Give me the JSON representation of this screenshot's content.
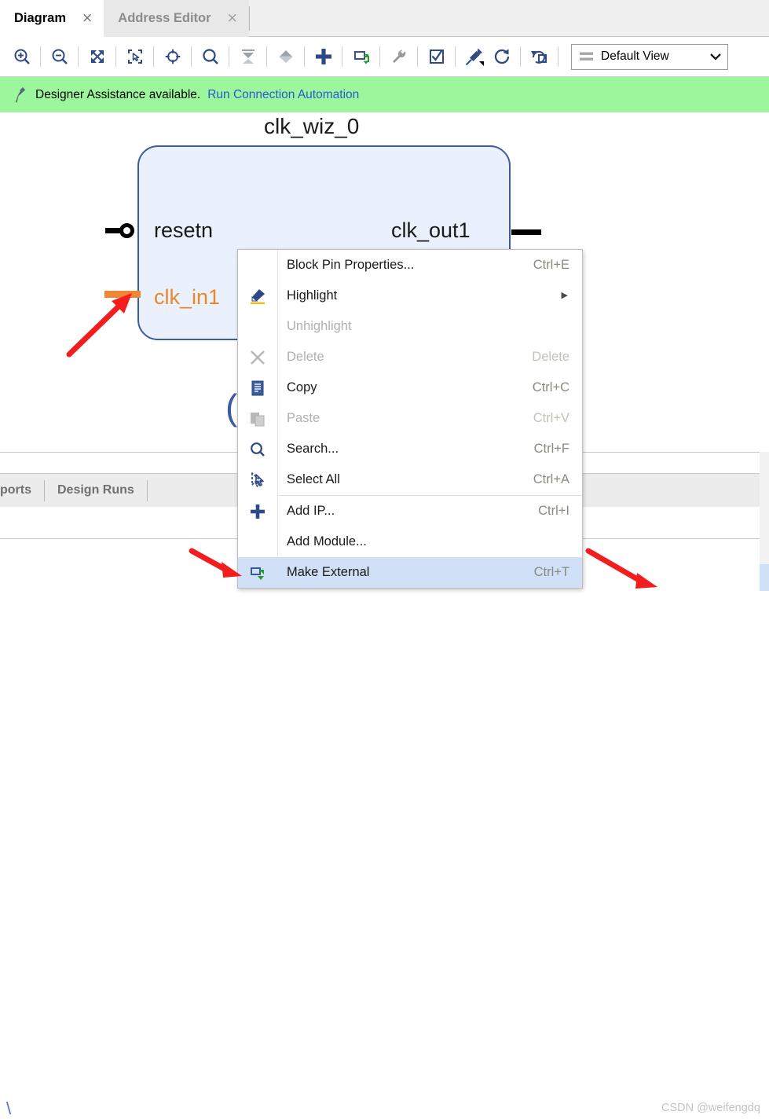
{
  "tabs": [
    {
      "label": "Diagram",
      "close": "×",
      "active": true
    },
    {
      "label": "Address Editor",
      "close": "×",
      "active": false
    }
  ],
  "toolbar": {
    "buttons": [
      {
        "name": "zoom-in-icon",
        "title": "Zoom In"
      },
      {
        "name": "zoom-out-icon",
        "title": "Zoom Out"
      },
      {
        "name": "zoom-fit-icon",
        "title": "Zoom Fit"
      },
      {
        "name": "zoom-area-icon",
        "title": "Zoom Area"
      },
      {
        "name": "fit-selection-icon",
        "title": "Fit Selection"
      },
      {
        "name": "search-icon",
        "title": "Search"
      },
      {
        "name": "collapse-all-icon",
        "title": "Collapse All"
      },
      {
        "name": "expand-all-icon",
        "title": "Expand All"
      },
      {
        "name": "add-ip-icon",
        "title": "Add IP"
      },
      {
        "name": "make-external-icon",
        "title": "Make External"
      },
      {
        "name": "settings-wrench-icon",
        "title": "Customize Block Design"
      },
      {
        "name": "validate-design-icon",
        "title": "Validate Design"
      },
      {
        "name": "pin-icon",
        "title": "Pin Lower Left"
      },
      {
        "name": "refresh-icon",
        "title": "Refresh"
      },
      {
        "name": "regenerate-layout-icon",
        "title": "Regenerate Layout"
      }
    ],
    "view_selector": {
      "label": "Default View",
      "chevron": "⌄"
    }
  },
  "assistance": {
    "icon": "designer-assistance-icon",
    "message": "Designer Assistance available.",
    "link": "Run Connection Automation",
    "background": "#9cf79c",
    "link_color": "#2a58d0"
  },
  "canvas": {
    "block": {
      "title": "clk_wiz_0",
      "fill": "#eaf1fd",
      "border": "#3b5c9e",
      "pins": [
        {
          "name": "resetn",
          "side": "left",
          "color": "#1a1a1a",
          "type": "bubble"
        },
        {
          "name": "clk_in1",
          "side": "left",
          "color": "#e8872a",
          "type": "highlighted"
        },
        {
          "name": "clk_out1",
          "side": "right",
          "color": "#1a1a1a",
          "type": "plain"
        }
      ],
      "sub_glyph": "("
    },
    "annotation_arrows": [
      {
        "name": "arrow-pointing-clk-in1-pin",
        "color": "#f41d1d"
      },
      {
        "name": "arrow-pointing-make-external",
        "color": "#f41d1d"
      },
      {
        "name": "arrow-pointing-scrollbar",
        "color": "#f41d1d"
      }
    ]
  },
  "context_menu": {
    "items": [
      {
        "label": "Block Pin Properties...",
        "accel": "Ctrl+E",
        "icon": "",
        "disabled": false,
        "submenu": false,
        "selected": false
      },
      {
        "label": "Highlight",
        "accel": "",
        "icon": "highlight-icon",
        "disabled": false,
        "submenu": true,
        "selected": false
      },
      {
        "label": "Unhighlight",
        "accel": "",
        "icon": "",
        "disabled": true,
        "submenu": false,
        "selected": false
      },
      {
        "label": "Delete",
        "accel": "Delete",
        "icon": "delete-x-icon",
        "disabled": true,
        "submenu": false,
        "selected": false
      },
      {
        "label": "Copy",
        "accel": "Ctrl+C",
        "icon": "copy-icon",
        "disabled": false,
        "submenu": false,
        "selected": false
      },
      {
        "label": "Paste",
        "accel": "Ctrl+V",
        "icon": "paste-icon",
        "disabled": true,
        "submenu": false,
        "selected": false
      },
      {
        "label": "Search...",
        "accel": "Ctrl+F",
        "icon": "search-icon",
        "disabled": false,
        "submenu": false,
        "selected": false
      },
      {
        "label": "Select All",
        "accel": "Ctrl+A",
        "icon": "select-all-cursor-icon",
        "disabled": false,
        "submenu": false,
        "selected": false
      },
      {
        "label": "Add IP...",
        "accel": "Ctrl+I",
        "icon": "plus-icon",
        "disabled": false,
        "submenu": false,
        "selected": false,
        "divider_before": true
      },
      {
        "label": "Add Module...",
        "accel": "",
        "icon": "",
        "disabled": false,
        "submenu": false,
        "selected": false
      },
      {
        "label": "Make External",
        "accel": "Ctrl+T",
        "icon": "make-external-icon",
        "disabled": false,
        "submenu": false,
        "selected": true
      }
    ],
    "selected_background": "#cfe0f7"
  },
  "bottom_panel": {
    "tabs": [
      {
        "label": "ports",
        "clipped": true
      },
      {
        "label": "Design Runs",
        "clipped": false
      }
    ]
  },
  "footer": {
    "console_prompt": "\\",
    "watermark": "CSDN @weifengdq"
  }
}
